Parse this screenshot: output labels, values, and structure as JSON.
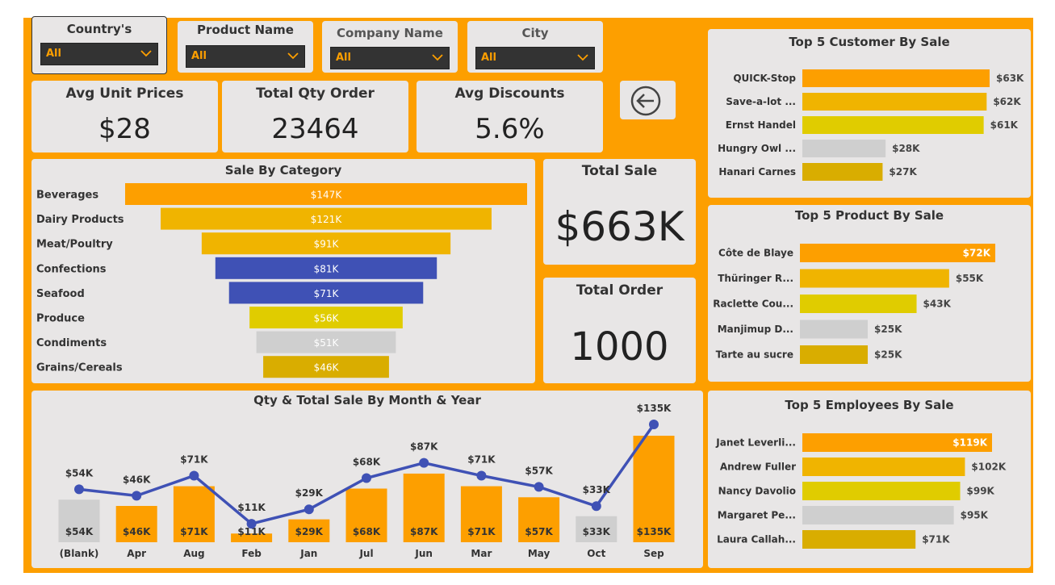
{
  "filters": [
    {
      "label": "Country's",
      "value": "All"
    },
    {
      "label": "Product Name",
      "value": "All"
    },
    {
      "label": "Company Name",
      "value": "All"
    },
    {
      "label": "City",
      "value": "All"
    }
  ],
  "kpis": {
    "avg_unit_price": {
      "title": "Avg Unit Prices",
      "value": "$28"
    },
    "total_qty": {
      "title": "Total Qty Order",
      "value": "23464"
    },
    "avg_discount": {
      "title": "Avg Discounts",
      "value": "5.6%"
    },
    "total_sale": {
      "title": "Total Sale",
      "value": "$663K"
    },
    "total_order": {
      "title": "Total Order",
      "value": "1000"
    }
  },
  "colors": {
    "orange": "#fd9f00",
    "amber": "#f0b400",
    "yellow": "#e0cc00",
    "blue": "#3f51b5",
    "gray": "#cfcfcf",
    "gold": "#d9ad00"
  },
  "icons": {
    "back": "back-arrow-icon",
    "dropdown": "chevron-down-icon"
  },
  "chart_data": [
    {
      "type": "bar",
      "subtype": "funnel",
      "title": "Sale By Category",
      "categories": [
        "Beverages",
        "Dairy Products",
        "Meat/Poultry",
        "Confections",
        "Seafood",
        "Produce",
        "Condiments",
        "Grains/Cereals"
      ],
      "values": [
        147,
        121,
        91,
        81,
        71,
        56,
        51,
        46
      ],
      "labels": [
        "$147K",
        "$121K",
        "$91K",
        "$81K",
        "$71K",
        "$56K",
        "$51K",
        "$46K"
      ],
      "colors": [
        "#fd9f00",
        "#f0b400",
        "#f0b400",
        "#3f51b5",
        "#3f51b5",
        "#e0cc00",
        "#cfcfcf",
        "#d9ad00"
      ]
    },
    {
      "type": "bar",
      "title": "Top 5 Customer By Sale",
      "categories": [
        "QUICK-Stop",
        "Save-a-lot ...",
        "Ernst Handel",
        "Hungry Owl ...",
        "Hanari Carnes"
      ],
      "values": [
        63,
        62,
        61,
        28,
        27
      ],
      "labels": [
        "$63K",
        "$62K",
        "$61K",
        "$28K",
        "$27K"
      ],
      "colors": [
        "#fd9f00",
        "#f0b400",
        "#e0cc00",
        "#cfcfcf",
        "#d9ad00"
      ]
    },
    {
      "type": "bar",
      "title": "Top 5 Product By Sale",
      "categories": [
        "Côte de Blaye",
        "Thüringer R...",
        "Raclette Cou...",
        "Manjimup D...",
        "Tarte au sucre"
      ],
      "values": [
        72,
        55,
        43,
        25,
        25
      ],
      "labels": [
        "$72K",
        "$55K",
        "$43K",
        "$25K",
        "$25K"
      ],
      "colors": [
        "#fd9f00",
        "#f0b400",
        "#e0cc00",
        "#cfcfcf",
        "#d9ad00"
      ]
    },
    {
      "type": "bar",
      "title": "Top 5 Employees By Sale",
      "categories": [
        "Janet Leverli...",
        "Andrew Fuller",
        "Nancy Davolio",
        "Margaret Pe...",
        "Laura Callah..."
      ],
      "values": [
        119,
        102,
        99,
        95,
        71
      ],
      "labels": [
        "$119K",
        "$102K",
        "$99K",
        "$95K",
        "$71K"
      ],
      "colors": [
        "#fd9f00",
        "#f0b400",
        "#e0cc00",
        "#cfcfcf",
        "#d9ad00"
      ]
    },
    {
      "type": "bar",
      "subtype": "combo-bar-line",
      "title": "Qty & Total Sale By Month & Year",
      "categories": [
        "(Blank)",
        "Apr",
        "Aug",
        "Feb",
        "Jan",
        "Jul",
        "Jun",
        "Mar",
        "May",
        "Oct",
        "Sep"
      ],
      "bar_values": [
        54,
        46,
        71,
        11,
        29,
        68,
        87,
        71,
        57,
        33,
        135
      ],
      "bar_labels": [
        "$54K",
        "$46K",
        "$71K",
        "$11K",
        "$29K",
        "$68K",
        "$87K",
        "$71K",
        "$57K",
        "$33K",
        "$135K"
      ],
      "bar_colors": [
        "#cfcfcf",
        "#fd9f00",
        "#fd9f00",
        "#fd9f00",
        "#fd9f00",
        "#fd9f00",
        "#fd9f00",
        "#fd9f00",
        "#fd9f00",
        "#cfcfcf",
        "#fd9f00"
      ],
      "line_values": [
        54,
        46,
        71,
        11,
        29,
        68,
        87,
        71,
        57,
        33,
        135
      ],
      "line_labels": [
        "$54K",
        "$46K",
        "$71K",
        "$11K",
        "$29K",
        "$68K",
        "$87K",
        "$71K",
        "$57K",
        "$33K",
        "$135K"
      ],
      "line_color": "#3f51b5"
    }
  ]
}
